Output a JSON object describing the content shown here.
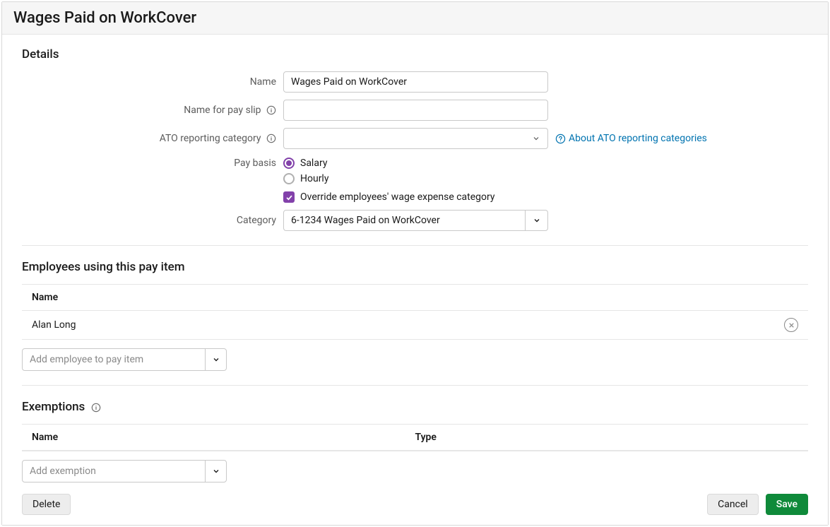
{
  "page_title": "Wages Paid on WorkCover",
  "details": {
    "section_title": "Details",
    "name_label": "Name",
    "name_value": "Wages Paid on WorkCover",
    "name_payslip_label": "Name for pay slip",
    "name_payslip_value": "",
    "ato_label": "ATO reporting category",
    "ato_value": "",
    "ato_link_text": "About ATO reporting categories",
    "pay_basis_label": "Pay basis",
    "pay_basis_options": {
      "salary": "Salary",
      "hourly": "Hourly"
    },
    "pay_basis_selected": "salary",
    "override_label": "Override employees' wage expense category",
    "override_checked": true,
    "category_label": "Category",
    "category_value": "6-1234  Wages Paid on WorkCover"
  },
  "employees": {
    "section_title": "Employees using this pay item",
    "name_header": "Name",
    "rows": [
      "Alan Long"
    ],
    "add_placeholder": "Add employee to pay item"
  },
  "exemptions": {
    "section_title": "Exemptions",
    "name_header": "Name",
    "type_header": "Type",
    "add_placeholder": "Add exemption"
  },
  "footer": {
    "delete": "Delete",
    "cancel": "Cancel",
    "save": "Save"
  },
  "colors": {
    "accent": "#8241aa",
    "link": "#0073b0",
    "save": "#0f8a3a"
  }
}
